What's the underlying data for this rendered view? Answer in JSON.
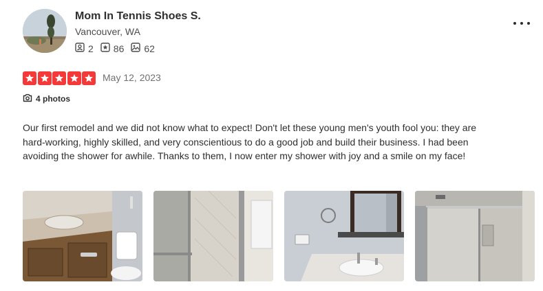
{
  "user": {
    "name": "Mom In Tennis Shoes S.",
    "location": "Vancouver, WA",
    "friends_count": "2",
    "reviews_count": "86",
    "photos_count": "62",
    "avatar_icon": "user-avatar-photo"
  },
  "review": {
    "rating": 5,
    "rating_color": "#f43939",
    "date": "May 12, 2023",
    "photos_label": "4 photos",
    "text": "Our first remodel and we did not know what to expect! Don't let these young men's youth fool you: they are hard-working, highly skilled, and very conscientious to do a good job and build their business. I had been avoiding the shower for awhile. Thanks to them, I now enter my shower with joy and a smile on my face!"
  },
  "icons": {
    "friends": "friends-icon",
    "reviews": "star-review-icon",
    "photos": "photo-icon",
    "camera": "camera-icon",
    "more": "more-options-icon"
  }
}
